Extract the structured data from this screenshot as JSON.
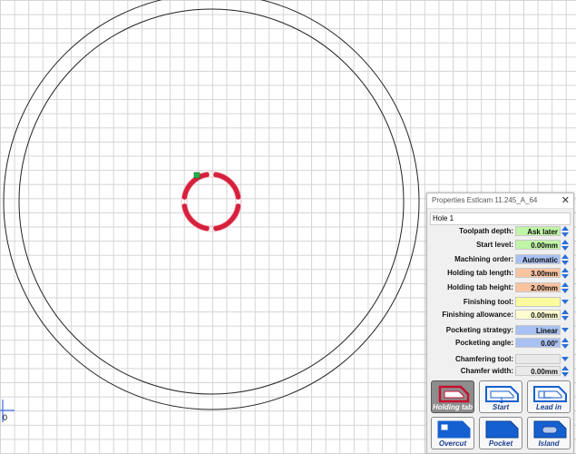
{
  "panel": {
    "title": "Properties Estlcam 11.245_A_64",
    "close_symbol": "✕",
    "hole_name": "Hole 1",
    "properties": [
      {
        "label": "Toolpath depth:",
        "value": "Ask later",
        "color": "#bff5a6",
        "control": "spinner"
      },
      {
        "label": "Start level:",
        "value": "0.00mm",
        "color": "#bff5a6",
        "control": "spinner"
      },
      {
        "label": "Machining order:",
        "value": "Automatic",
        "color": "#a9c1f2",
        "control": "spinner"
      },
      {
        "label": "Holding tab length:",
        "value": "3.00mm",
        "color": "#f9c3a0",
        "control": "spinner"
      },
      {
        "label": "Holding tab height:",
        "value": "2.00mm",
        "color": "#f9c3a0",
        "control": "spinner"
      },
      {
        "label": "Finishing tool:",
        "value": "",
        "color": "#fbfb9e",
        "control": "dropdown"
      },
      {
        "label": "Finishing allowance:",
        "value": "0.00mm",
        "color": "#fdfdd0",
        "control": "spinner"
      },
      {
        "label": "Pocketing strategy:",
        "value": "Linear",
        "color": "#a9c1f2",
        "control": "dropdown"
      },
      {
        "label": "Pocketing angle:",
        "value": "0.00°",
        "color": "#a9c1f2",
        "control": "spinner"
      },
      {
        "label": "Chamfering tool:",
        "value": "",
        "color": "#e9e9e9",
        "control": "dropdown"
      },
      {
        "label": "Chamfer width:",
        "value": "0.00mm",
        "color": "#e9e9e9",
        "control": "spinner"
      }
    ],
    "tools": [
      {
        "label": "Holding tab",
        "icon": "holding-tab-icon",
        "active": true
      },
      {
        "label": "Start",
        "icon": "start-icon",
        "active": false
      },
      {
        "label": "Lead in",
        "icon": "lead-in-icon",
        "active": false
      },
      {
        "label": "Overcut",
        "icon": "overcut-icon",
        "active": false
      },
      {
        "label": "Pocket",
        "icon": "pocket-icon",
        "active": false
      },
      {
        "label": "Island",
        "icon": "island-icon",
        "active": false
      }
    ]
  },
  "canvas": {
    "origin_label": "0",
    "toolpath_color": "#d6203c",
    "start_marker_color": "#22b14c"
  }
}
